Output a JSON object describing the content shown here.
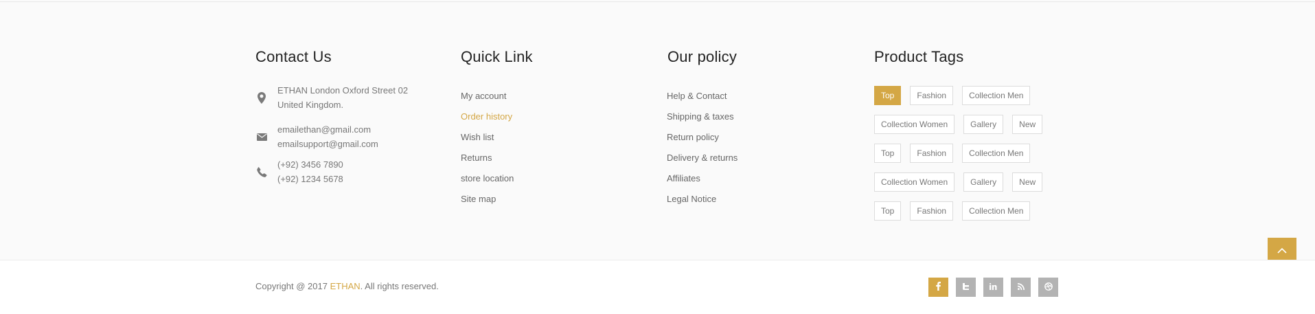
{
  "contact": {
    "title": "Contact Us",
    "address": [
      "ETHAN London Oxford Street 02",
      "United Kingdom."
    ],
    "emails": [
      "emailethan@gmail.com",
      "emailsupport@gmail.com"
    ],
    "phones": [
      "(+92) 3456 7890",
      "(+92) 1234 5678"
    ]
  },
  "quick_link": {
    "title": "Quick Link",
    "items": [
      "My account",
      "Order history",
      "Wish list",
      "Returns",
      "store location",
      "Site map"
    ]
  },
  "policy": {
    "title": "Our policy",
    "items": [
      "Help & Contact",
      "Shipping & taxes",
      "Return policy",
      "Delivery & returns",
      "Affiliates",
      "Legal Notice"
    ]
  },
  "tags": {
    "title": "Product Tags",
    "rows": [
      [
        "Top",
        "Fashion",
        "Collection Men"
      ],
      [
        "Collection Women",
        "Gallery",
        "New"
      ],
      [
        "Top",
        "Fashion",
        "Collection Men"
      ],
      [
        "Collection Women",
        "Gallery",
        "New"
      ],
      [
        "Top",
        "Fashion",
        "Collection Men"
      ]
    ]
  },
  "footer": {
    "copyright_prefix": "Copyright @ 2017 ",
    "brand": "ETHAN",
    "copyright_suffix": ". All rights reserved."
  },
  "social": {
    "facebook": "f",
    "twitter": "t",
    "linkedin": "in",
    "rss": "rss",
    "dribbble": "dribbble"
  },
  "colors": {
    "accent": "#d4a745",
    "icon_gray": "#b3b3b3",
    "text": "#777777"
  }
}
